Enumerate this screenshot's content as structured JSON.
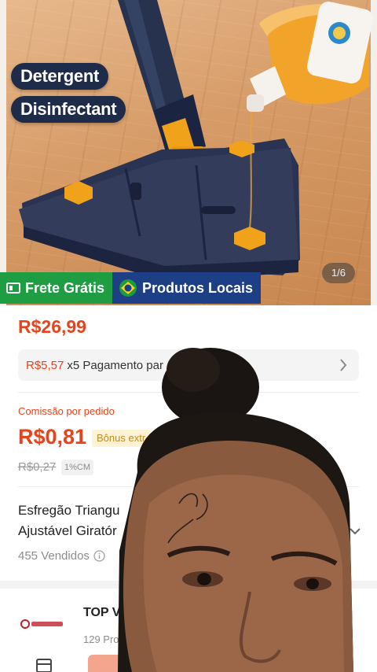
{
  "hero": {
    "labels": [
      "Detergent",
      "Disinfectant"
    ],
    "page_indicator": "1/6",
    "badges": {
      "shipping": "Frete Grátis",
      "local": "Produtos Locais"
    }
  },
  "product": {
    "price": "R$26,99",
    "installment_amount": "R$5,57",
    "installment_text": "x5 Pagamento par",
    "commission_label": "Comissão por pedido",
    "commission_value": "R$0,81",
    "bonus_tag": "Bônus extr",
    "old_commission": "R$0,27",
    "commission_rate": "1%CM",
    "title": "Esfregão Triangu\nAjustável Giratór",
    "sold": "455 Vendidos"
  },
  "shop": {
    "name": "TOP VI",
    "subtitle": "129 Produ"
  },
  "icons": {
    "shipping": "truck-icon",
    "flag": "brazil-flag-icon",
    "installment": "chevron-right-icon",
    "info": "info-icon",
    "expand": "chevron-down-icon",
    "store": "store-icon"
  },
  "colors": {
    "price_accent": "#e8431a",
    "shipping_badge": "#1f9d43",
    "local_badge": "#1c3f86",
    "label_pill": "#1e2b49"
  }
}
